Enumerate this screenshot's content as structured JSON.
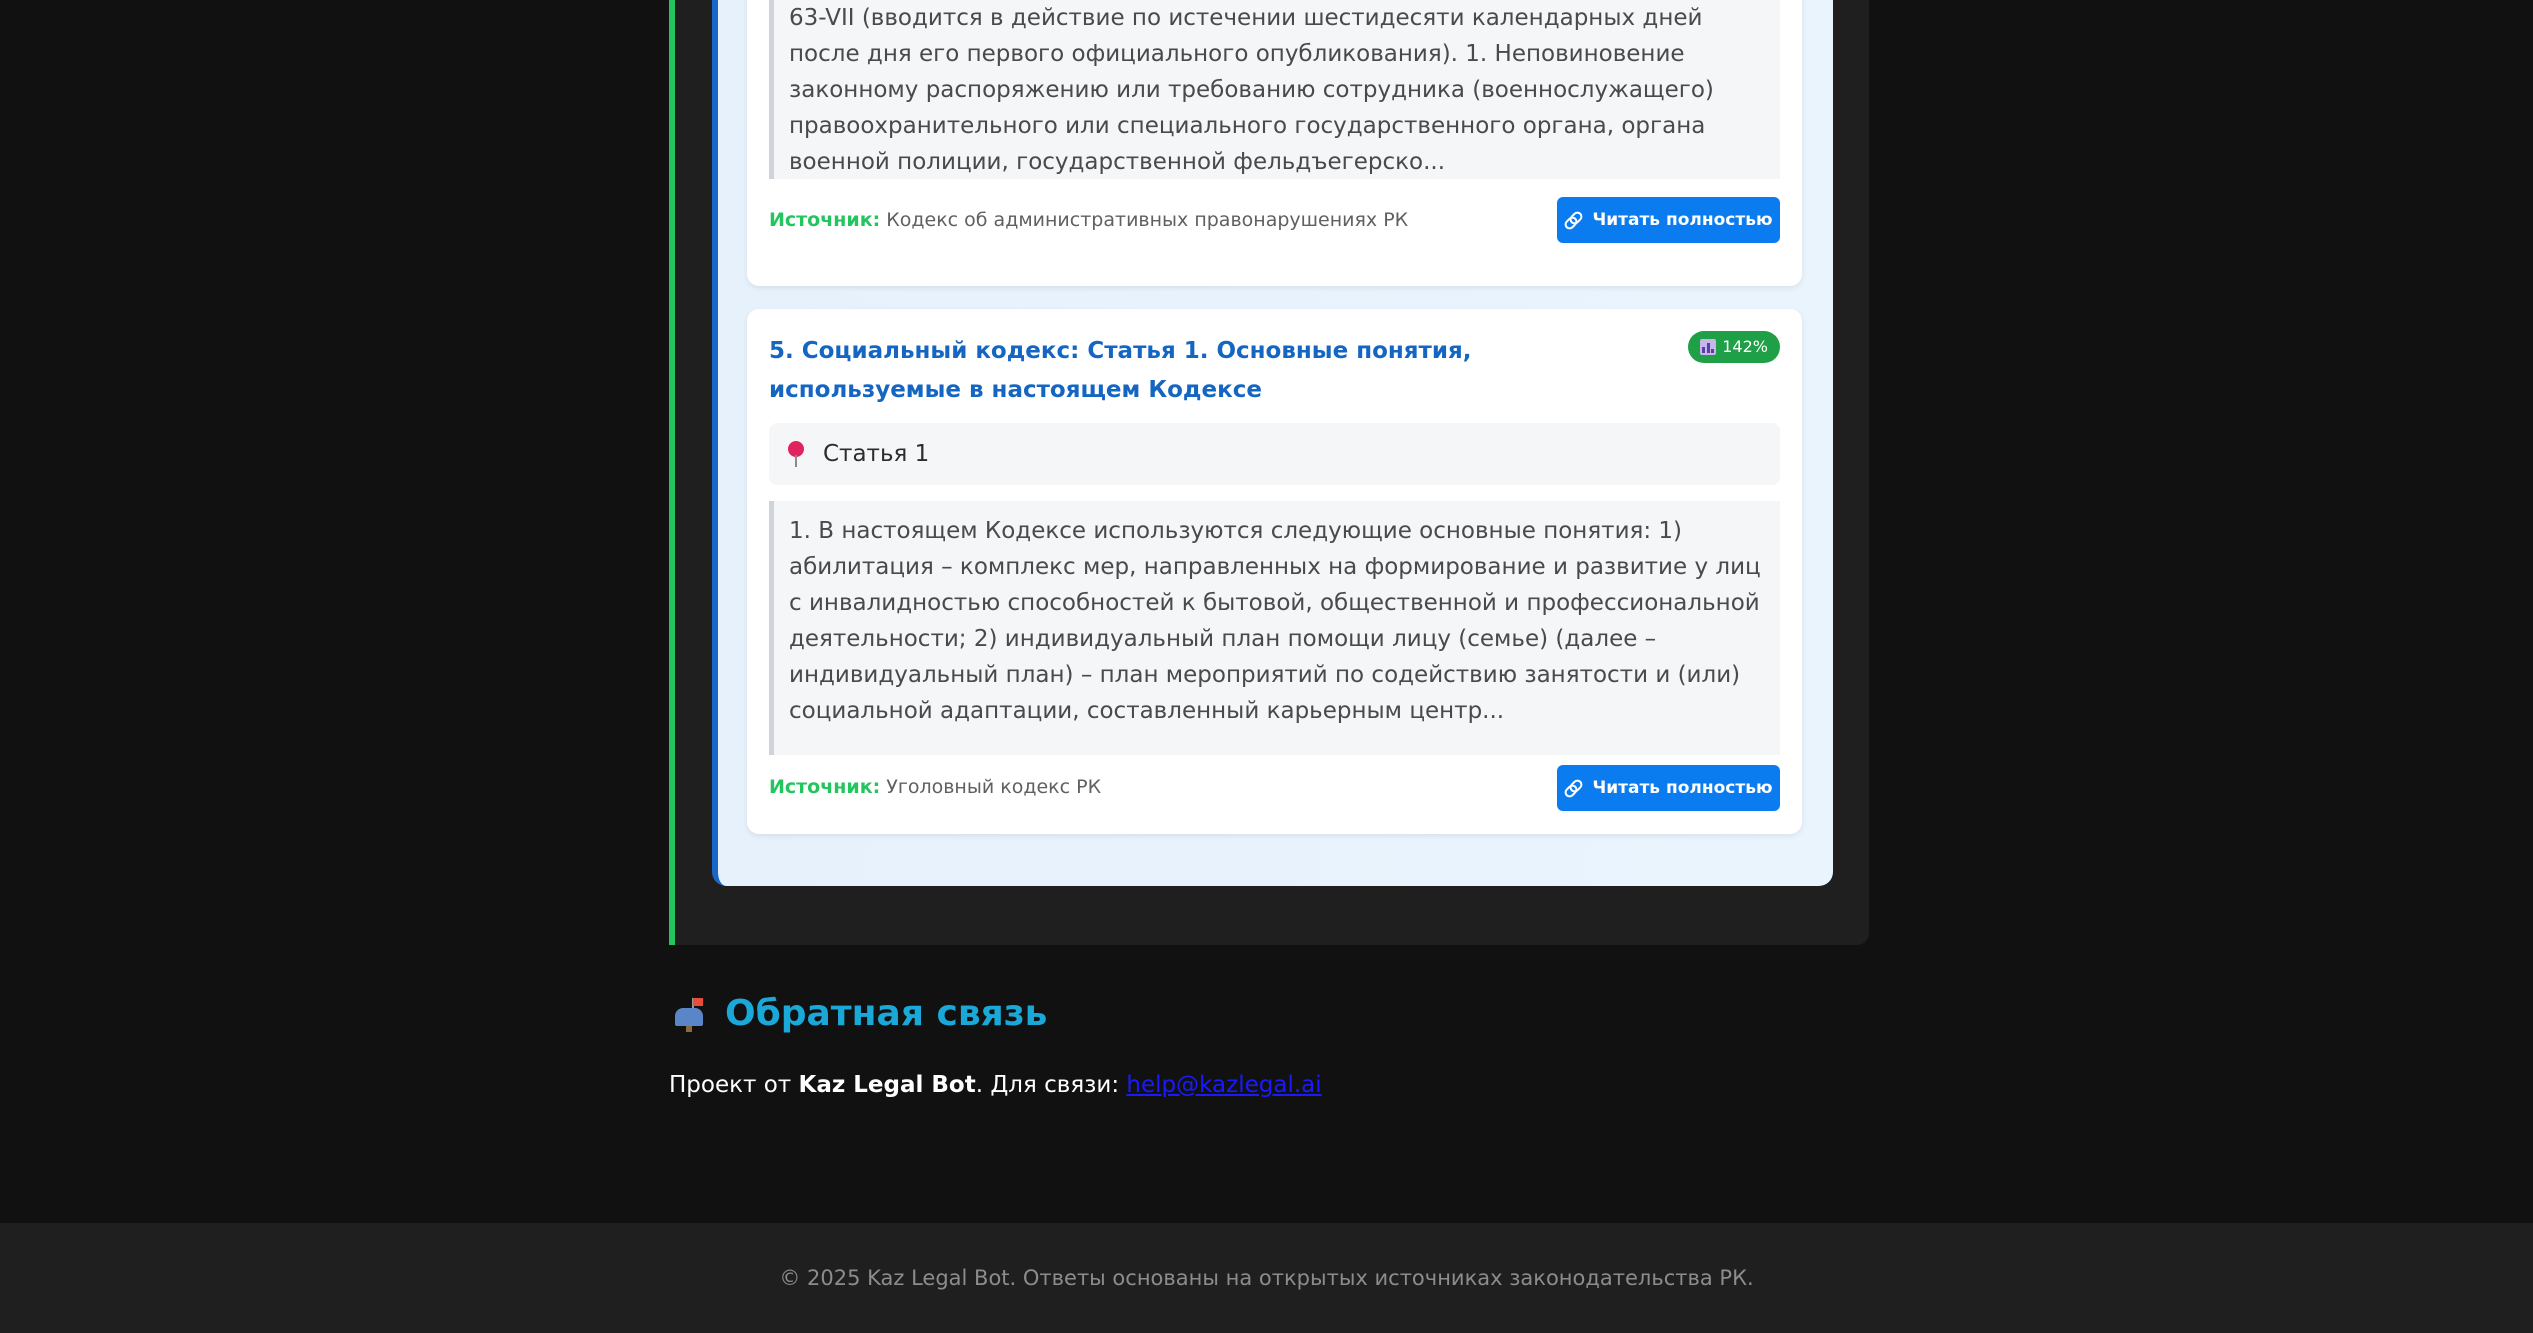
{
  "results": [
    {
      "excerpt": "63-VII (вводится в действие по истечении шестидесяти календарных дней после дня его первого официального опубликования). 1. Неповиновение законному распоряжению или требованию сотрудника (военнослужащего) правоохранительного или специального государственного органа, органа военной полиции, государственной фельдъегерско...",
      "source_label": "Источник:",
      "source_value": "Кодекс об административных правонарушениях РК",
      "read_more_label": "Читать полностью"
    },
    {
      "title": "5. Социальный кодекс: Статья 1. Основные понятия, используемые в настоящем Кодексе",
      "score": "142%",
      "article": "Статья 1",
      "excerpt": "1. В настоящем Кодексе используются следующие основные понятия: 1) абилитация – комплекс мер, направленных на формирование и развитие у лиц с инвалидностью способностей к бытовой, общественной и профессиональной деятельности; 2) индивидуальный план помощи лицу (семье) (далее – индивидуальный план) – план мероприятий по содействию занятости и (или) социальной адаптации, составленный карьерным центр...",
      "source_label": "Источник:",
      "source_value": "Уголовный кодекс РК",
      "read_more_label": "Читать полностью"
    }
  ],
  "feedback": {
    "icon": "mailbox-icon",
    "title": "Обратная связь",
    "text_prefix": "Проект от ",
    "project_name": "Kaz Legal Bot",
    "text_middle": ". Для связи: ",
    "email": "help@kazlegal.ai"
  },
  "footer": {
    "text": "© 2025 Kaz Legal Bot. Ответы основаны на открытых источниках законодательства РК."
  },
  "colors": {
    "accent_green": "#22c55e",
    "accent_blue": "#1a66c8",
    "button_blue": "#0b7cf0",
    "title_blue": "#1466c2",
    "feedback_cyan": "#1aa8d8",
    "badge_green": "#1fa046"
  }
}
